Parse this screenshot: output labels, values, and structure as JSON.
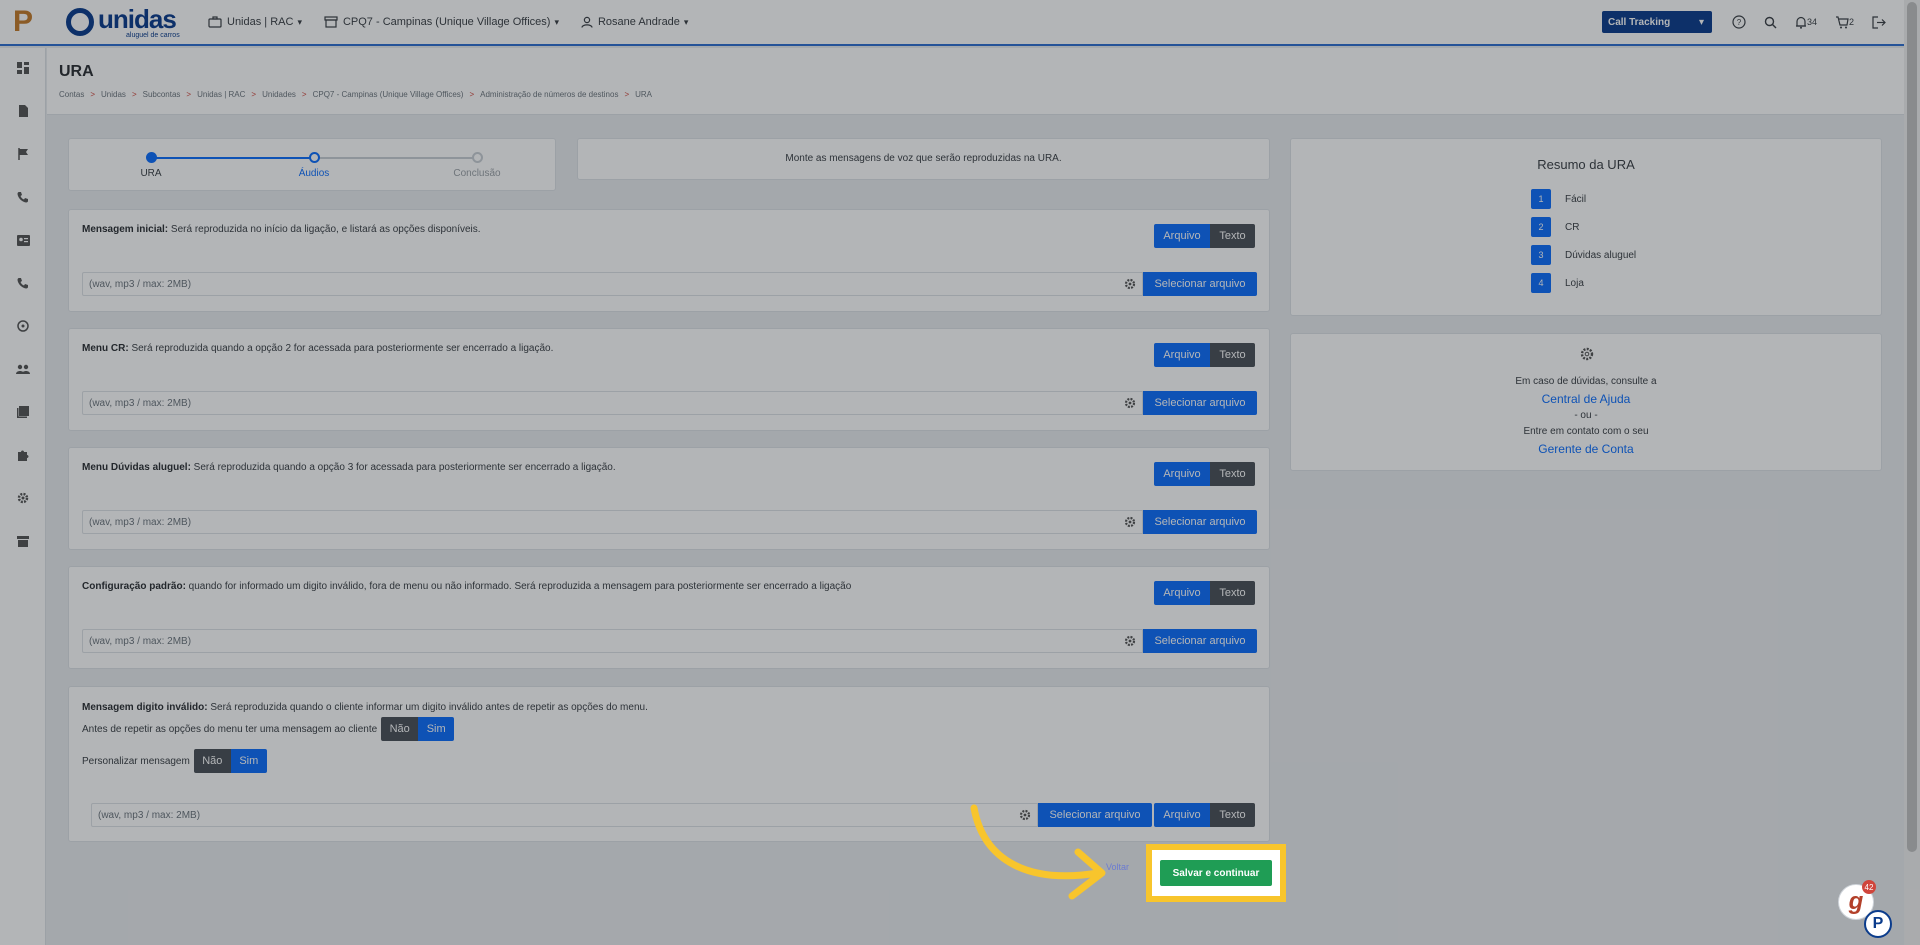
{
  "header": {
    "company": "Unidas | RAC",
    "unit": "CPQ7 - Campinas (Unique Village Offices)",
    "user": "Rosane Andrade",
    "call_tracking": "Call Tracking",
    "notifications": "34",
    "cart": "2",
    "brand_name": "unidas",
    "brand_sub": "aluguel de carros",
    "logo_letter": "P"
  },
  "page": {
    "title": "URA",
    "breadcrumb": [
      "Contas",
      "Unidas",
      "Subcontas",
      "Unidas | RAC",
      "Unidades",
      "CPQ7 - Campinas (Unique Village Offices)",
      "Administração de números de destinos",
      "URA"
    ],
    "breadcrumb_sep": ">"
  },
  "stepper": {
    "steps": [
      "URA",
      "Áudios",
      "Conclusão"
    ],
    "current": 2
  },
  "info": "Monte as mensagens de voz que serão reproduzidas na URA.",
  "labels": {
    "arquivo": "Arquivo",
    "texto": "Texto",
    "placeholder": "(wav, mp3 / max: 2MB)",
    "select_file": "Selecionar arquivo",
    "nao": "Não",
    "sim": "Sim"
  },
  "messages": [
    {
      "title": "Mensagem inicial:",
      "desc": " Será reproduzida no início da ligação, e listará as opções disponíveis."
    },
    {
      "title": "Menu CR:",
      "desc": " Será reproduzida quando a opção 2 for acessada para posteriormente ser encerrado a ligação."
    },
    {
      "title": "Menu Dúvidas aluguel:",
      "desc": " Será reproduzida quando a opção 3 for acessada para posteriormente ser encerrado a ligação."
    },
    {
      "title": "Configuração padrão:",
      "desc": " quando for informado um digito inválido, fora de menu ou não informado. Será reproduzida a mensagem para posteriormente ser encerrado a ligação"
    }
  ],
  "invalid_digit": {
    "title": "Mensagem digito inválido:",
    "desc": " Será reproduzida quando o cliente informar um digito inválido antes de repetir as opções do menu.",
    "question1": "Antes de repetir as opções do menu ter uma mensagem ao cliente",
    "question2": "Personalizar mensagem"
  },
  "summary": {
    "title": "Resumo da URA",
    "items": [
      {
        "num": "1",
        "label": "Fácil"
      },
      {
        "num": "2",
        "label": "CR"
      },
      {
        "num": "3",
        "label": "Dúvidas aluguel"
      },
      {
        "num": "4",
        "label": "Loja"
      }
    ]
  },
  "help": {
    "line1": "Em caso de dúvidas, consulte a",
    "link1": "Central de Ajuda",
    "or": "- ou -",
    "line2": "Entre em contato com o seu",
    "link2": "Gerente de Conta"
  },
  "footer": {
    "back": "Voltar",
    "save": "Salvar e continuar"
  },
  "chat": {
    "badge": "42",
    "letter": "g",
    "letter2": "P"
  },
  "colors": {
    "primary": "#0d6efd",
    "brand": "#0b3c8c",
    "save": "#1f9d55",
    "highlight": "#f8c52c"
  }
}
